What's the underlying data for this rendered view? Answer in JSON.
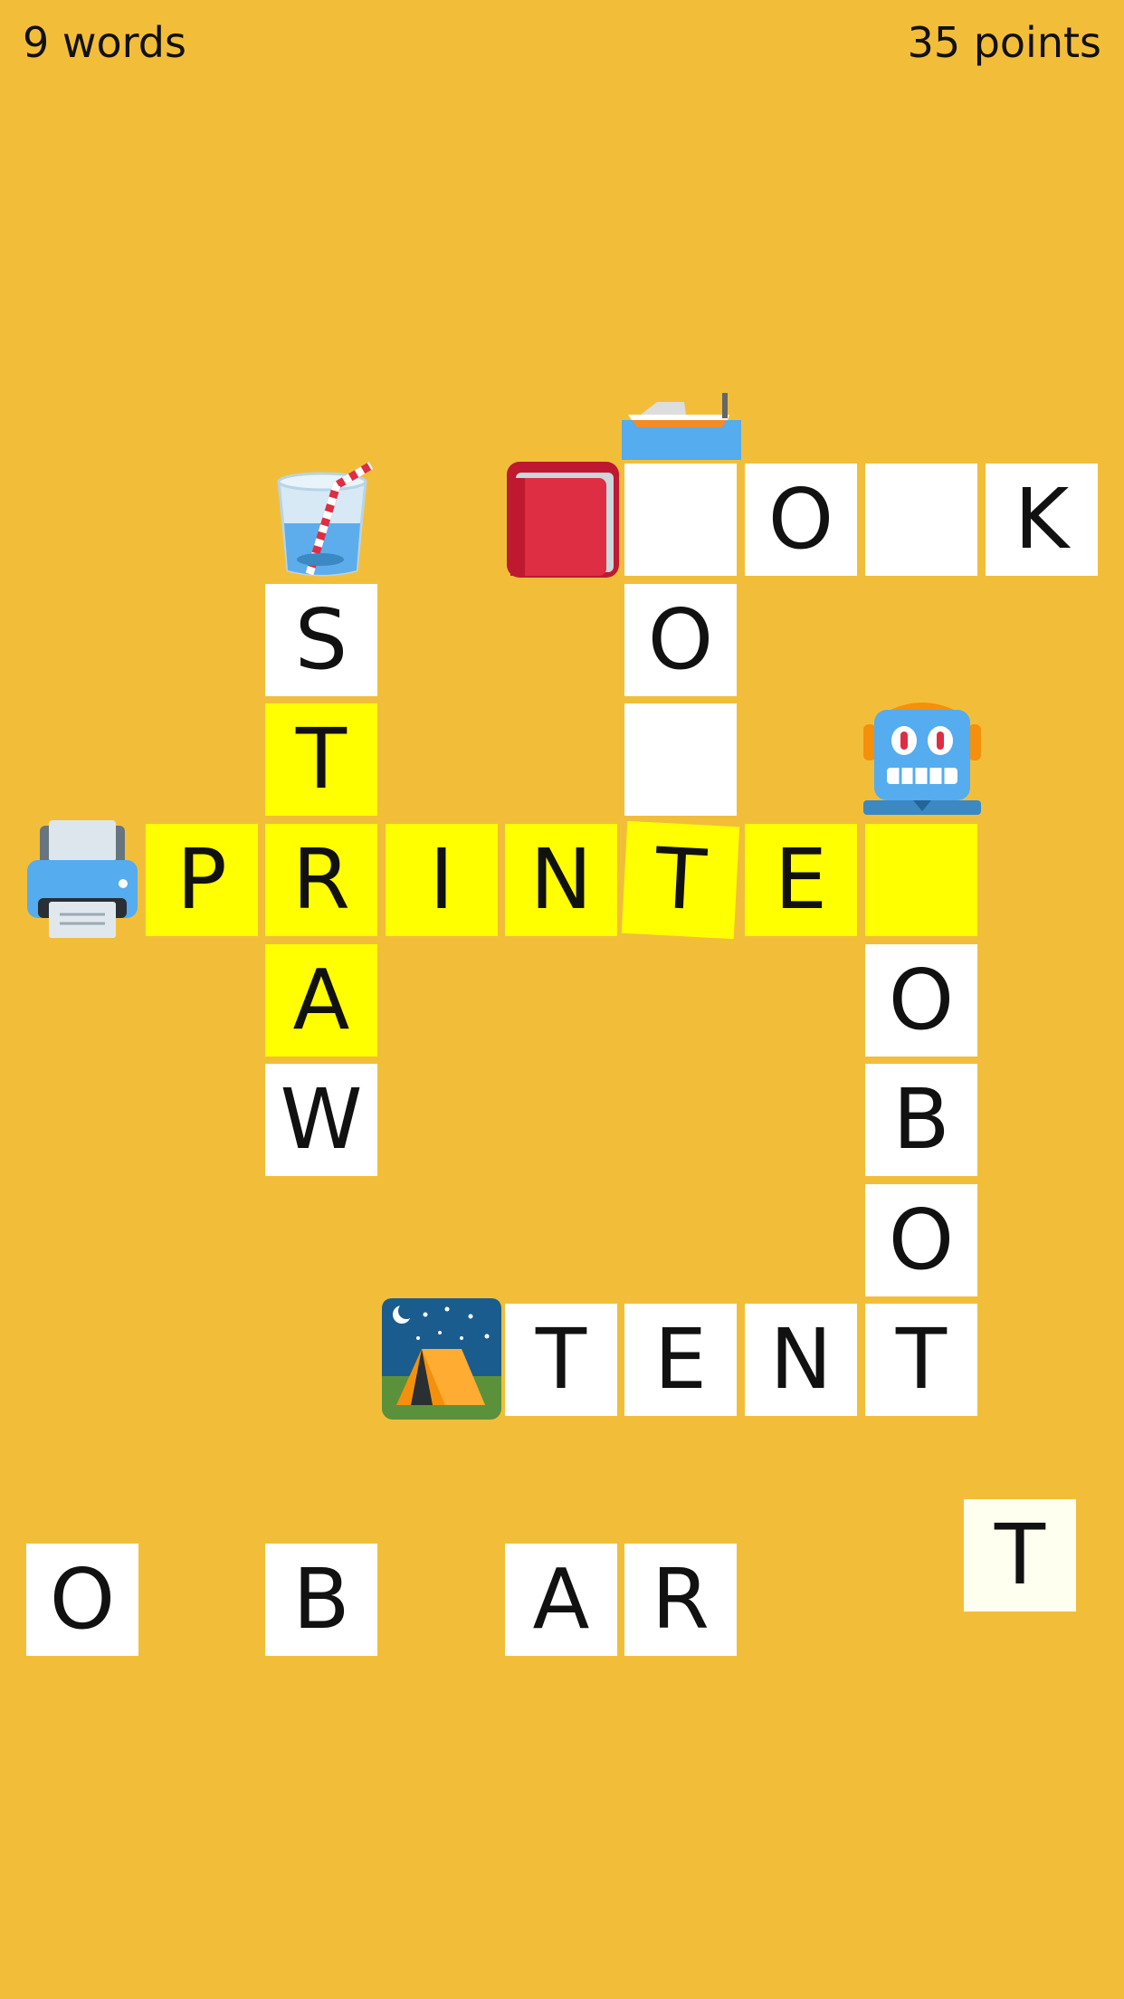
{
  "hud": {
    "words": "9 words",
    "points": "35 points"
  },
  "icons": [
    "boat-icon",
    "book-icon",
    "drink-icon",
    "robot-icon",
    "printer-icon",
    "tent-icon"
  ],
  "colors": {
    "background": "#F2BE3A",
    "tile": "#FFFFFF",
    "highlight": "#FFFF00",
    "loose_tile": "#FFFFF0"
  },
  "board": {
    "boat": [
      "",
      "O",
      "",
      "K"
    ],
    "book": [
      "",
      "O",
      ""
    ],
    "straw": [
      "S",
      "T",
      "R",
      "A",
      "W"
    ],
    "printer": [
      "P",
      "R",
      "I",
      "N",
      "T",
      "E",
      ""
    ],
    "robot": [
      "O",
      "B",
      "O",
      "T"
    ],
    "tent": [
      "T",
      "E",
      "N",
      "T"
    ]
  },
  "tray": [
    "O",
    "B",
    "A",
    "R",
    "T"
  ]
}
